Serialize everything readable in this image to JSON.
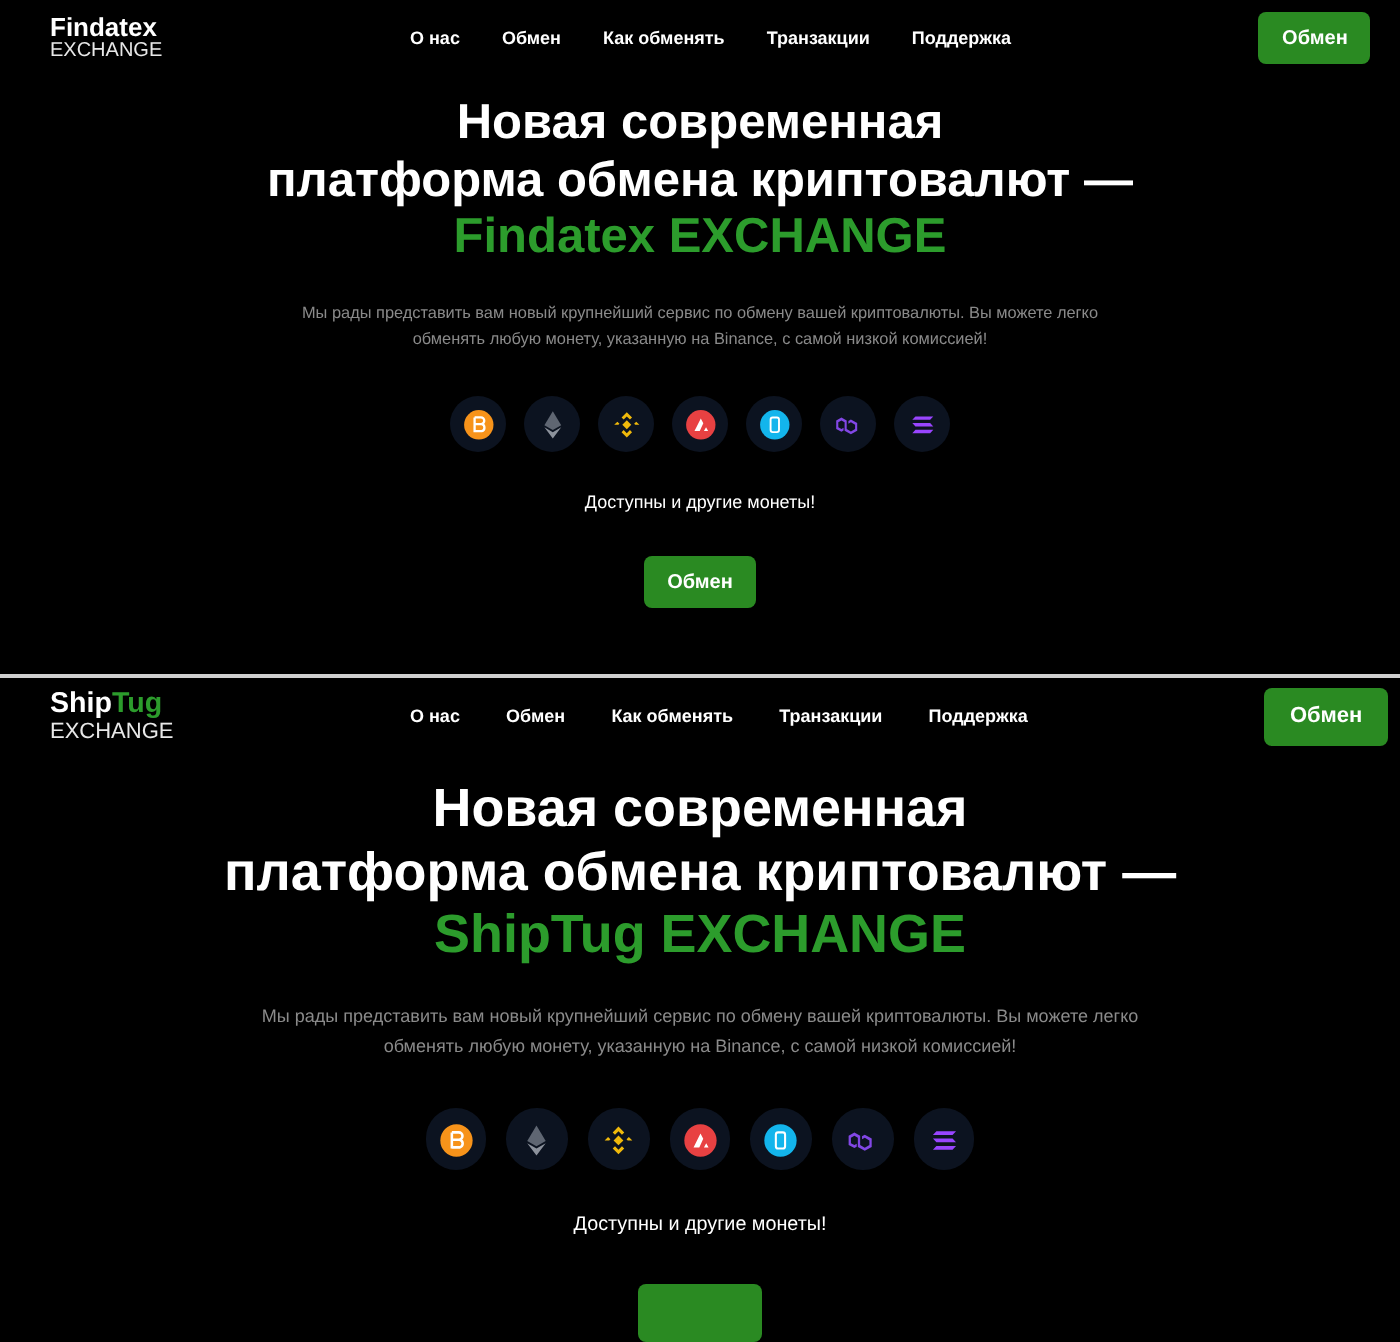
{
  "panels": [
    {
      "brand": [
        {
          "text": "Findatex",
          "accent": false
        }
      ],
      "brand_sub": "EXCHANGE",
      "nav": [
        "О нас",
        "Обмен",
        "Как обменять",
        "Транзакции",
        "Поддержка"
      ],
      "header_button": "Обмен",
      "title_lines": [
        "Новая современная",
        "платформа обмена криптовалют —"
      ],
      "title_accent": "Findatex EXCHANGE",
      "intro": "Мы рады представить вам новый крупнейший сервис по обмену вашей криптовалюты. Вы можете легко обменять любую монету, указанную на Binance, с самой низкой комиссией!",
      "coins": [
        {
          "kind": "bitcoin",
          "color": "#f7931a"
        },
        {
          "kind": "ethereum",
          "color": "#5f6672"
        },
        {
          "kind": "bnb",
          "color": "#f0b90b"
        },
        {
          "kind": "avalanche",
          "color": "#e84142"
        },
        {
          "kind": "fantom",
          "color": "#13b5ec"
        },
        {
          "kind": "polygon",
          "color": "#8247e5"
        },
        {
          "kind": "solana",
          "color": "#9945ff"
        }
      ],
      "more_coins": "Доступны и другие монеты!",
      "cta": "Обмен"
    },
    {
      "brand": [
        {
          "text": "Ship",
          "accent": false
        },
        {
          "text": "Tug",
          "accent": true
        }
      ],
      "brand_sub": "EXCHANGE",
      "nav": [
        "О нас",
        "Обмен",
        "Как обменять",
        "Транзакции",
        "Поддержка"
      ],
      "header_button": "Обмен",
      "title_lines": [
        "Новая современная",
        "платформа обмена криптовалют —"
      ],
      "title_accent": "ShipTug EXCHANGE",
      "intro": "Мы рады представить вам новый крупнейший сервис по обмену вашей криптовалюты. Вы можете легко обменять любую монету, указанную на Binance, с самой низкой комиссией!",
      "coins": [
        {
          "kind": "bitcoin",
          "color": "#f7931a"
        },
        {
          "kind": "ethereum",
          "color": "#5f6672"
        },
        {
          "kind": "bnb",
          "color": "#f0b90b"
        },
        {
          "kind": "avalanche",
          "color": "#e84142"
        },
        {
          "kind": "fantom",
          "color": "#13b5ec"
        },
        {
          "kind": "polygon",
          "color": "#8247e5"
        },
        {
          "kind": "solana",
          "color": "#9945ff"
        }
      ],
      "more_coins": "Доступны и другие монеты!"
    }
  ]
}
